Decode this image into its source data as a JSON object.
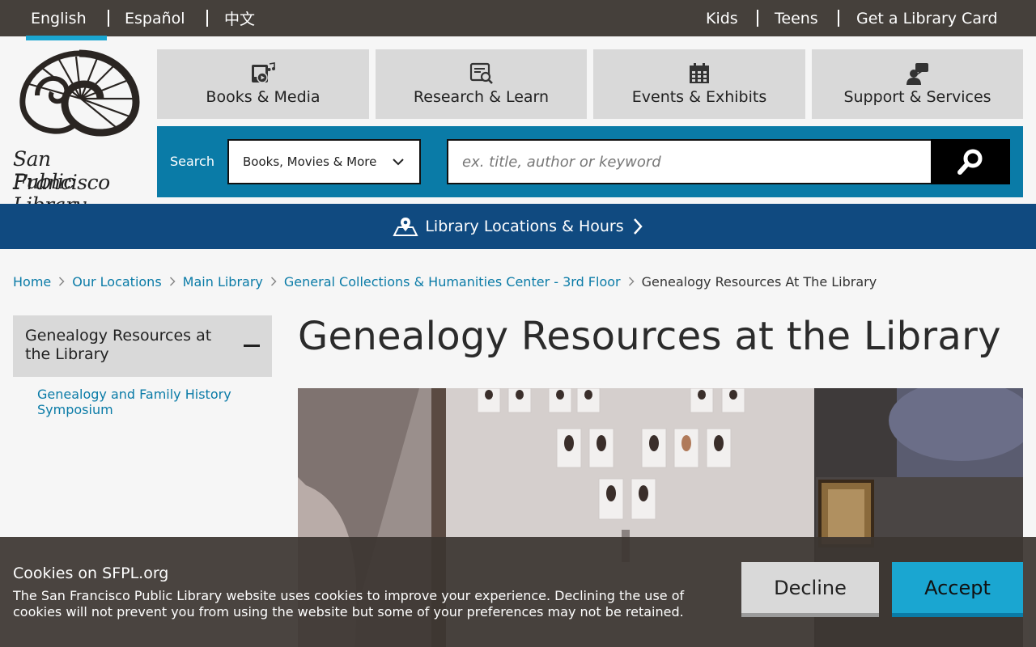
{
  "topbar": {
    "languages": [
      "English",
      "Español",
      "中文"
    ],
    "links": [
      "Kids",
      "Teens",
      "Get a Library Card"
    ]
  },
  "logo": {
    "line1": "San Francisco",
    "line2": "Public Library"
  },
  "nav": [
    {
      "label": "Books & Media",
      "icon": "media-icon"
    },
    {
      "label": "Research & Learn",
      "icon": "research-icon"
    },
    {
      "label": "Events & Exhibits",
      "icon": "calendar-icon"
    },
    {
      "label": "Support & Services",
      "icon": "support-icon"
    }
  ],
  "search": {
    "label": "Search",
    "scope": "Books, Movies & More",
    "placeholder": "ex. title, author or keyword"
  },
  "locations": {
    "label": "Library Locations & Hours"
  },
  "breadcrumb": [
    "Home",
    "Our Locations",
    "Main Library",
    "General Collections & Humanities Center - 3rd Floor",
    "Genealogy Resources At The Library"
  ],
  "sidebar": {
    "heading": "Genealogy Resources at the Library",
    "items": [
      "Genealogy and Family History Symposium"
    ]
  },
  "main": {
    "title": "Genealogy Resources at the Library"
  },
  "cookie": {
    "title": "Cookies on SFPL.org",
    "text": "The San Francisco Public Library website uses cookies to improve your experience. Declining the use of cookies will not prevent you from using the website but some of your preferences may not be retained.",
    "decline": "Decline",
    "accept": "Accept"
  },
  "colors": {
    "topbar": "#45403b",
    "accent": "#1aa6d1",
    "search_band": "#0a7ba7",
    "locations_bar": "#104a80",
    "tile": "#d9d9d9"
  }
}
